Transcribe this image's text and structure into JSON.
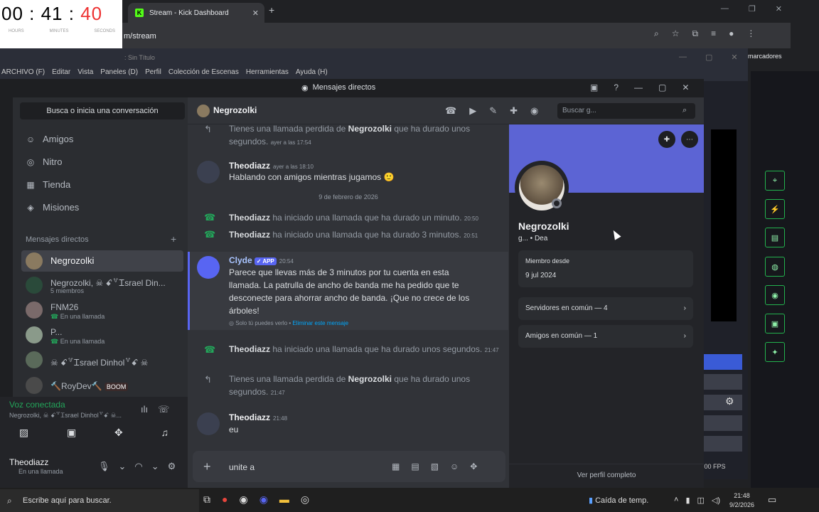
{
  "timer": {
    "hours": "00",
    "minutes": "41",
    "seconds": "40",
    "h_label": "HOURS",
    "m_label": "MINUTES",
    "s_label": "SECONDS"
  },
  "browser": {
    "tab_title": "Stream - Kick Dashboard",
    "url_tail": "m/stream",
    "bookmarks": "marcadores",
    "new_tab": "+",
    "tab_close": "✕"
  },
  "obs": {
    "title": ": Sin Título",
    "menu": [
      "ARCHIVO (F)",
      "Editar",
      "Vista",
      "Paneles (D)",
      "Perfil",
      "Colección de Escenas",
      "Herramientas",
      "Ayuda (H)"
    ],
    "fps": ".00 FPS"
  },
  "discord": {
    "window_title": "Mensajes directos",
    "search_placeholder": "Busca o inicia una conversación",
    "nav": [
      {
        "label": "Amigos",
        "icon": "friends-icon"
      },
      {
        "label": "Nitro",
        "icon": "nitro-icon"
      },
      {
        "label": "Tienda",
        "icon": "shop-icon"
      },
      {
        "label": "Misiones",
        "icon": "quests-icon"
      }
    ],
    "dm_header": "Mensajes directos",
    "dms": [
      {
        "name": "Negrozolki",
        "sub": ""
      },
      {
        "name": "Negrozolki, ☠ ꗃ꒷Ꮖsrael Din...",
        "sub": "5 miembros"
      },
      {
        "name": "FNM26",
        "sub": "En una llamada"
      },
      {
        "name": "P...",
        "sub": "En una llamada"
      },
      {
        "name": "☠ ꗃ꒷Ꮖsrael Dinhol꒷ꗃ ☠",
        "sub": ""
      },
      {
        "name": "🔨RoyDev🔨",
        "sub": "",
        "badge": "BOOM"
      }
    ],
    "voice": {
      "status": "Voz conectada",
      "channel": "Negrozolki, ☠ ꗃ꒷Ꮖsrael Dinhol꒷ꗃ ☠..."
    },
    "user": {
      "name": "Theodiazz",
      "status": "En una llamada"
    },
    "chat": {
      "recipient": "Negrozolki",
      "search_placeholder": "Buscar g...",
      "date_divider": "9 de febrero de 2026",
      "m1": {
        "text_a": "Tienes una llamada perdida de ",
        "bold": "Negrozolki",
        "text_b": " que ha durado unos segundos.",
        "time": "ayer a las 17:54"
      },
      "m2": {
        "author": "Theodiazz",
        "time": "ayer a las 18:10",
        "text": "Hablando con amigos mientras jugamos 🙂"
      },
      "m3": {
        "author": "Theodiazz",
        "text": " ha iniciado una llamada que ha durado un minuto.",
        "time": "20:50"
      },
      "m4": {
        "author": "Theodiazz",
        "text": " ha iniciado una llamada que ha durado 3 minutos.",
        "time": "20:51"
      },
      "m5": {
        "author": "Clyde",
        "badge": "✓ APP",
        "time": "20:54",
        "text": "Parece que llevas más de 3 minutos por tu cuenta en esta llamada. La patrulla de ancho de banda me ha pedido que te desconecte para ahorrar ancho de banda. ¡Que no crece de los árboles!",
        "note": "Solo tú puedes verlo • ",
        "note_link": "Eliminar este mensaje"
      },
      "m6": {
        "author": "Theodiazz",
        "text": " ha iniciado una llamada que ha durado unos segundos.",
        "time": "21:47"
      },
      "m7": {
        "text_a": "Tienes una llamada perdida de ",
        "bold": "Negrozolki",
        "text_b": " que ha durado unos segundos.",
        "time": "21:47"
      },
      "m8": {
        "author": "Theodiazz",
        "time": "21:48",
        "text": "eu"
      },
      "input": "unite a "
    },
    "profile": {
      "name": "Negrozolki",
      "tag": "g... • Dea",
      "member_label": "Miembro desde",
      "member_date": "9 jul 2024",
      "servers": "Servidores en común — 4",
      "friends": "Amigos en común — 1",
      "full": "Ver perfil completo"
    }
  },
  "taskbar": {
    "search": "Escribe aquí para buscar.",
    "weather": "Caída de temp.",
    "time": "21:48",
    "date": "9/2/2026"
  },
  "colors": {
    "blurple": "#5865f2",
    "green": "#23a55a",
    "banner": "#5c64d4"
  }
}
